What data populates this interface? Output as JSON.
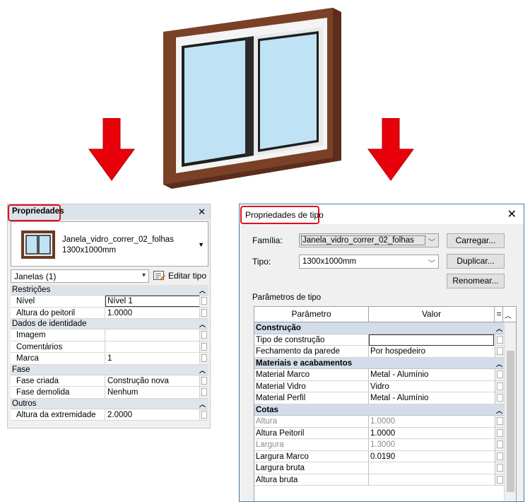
{
  "left_panel": {
    "title": "Propriedades",
    "close": "✕",
    "type_name": "Janela_vidro_correr_02_folhas",
    "type_size": "1300x1000mm",
    "type_dropdown": "▼",
    "instance_filter": "Janelas (1)",
    "edit_type": "Editar tipo",
    "categories": [
      {
        "name": "Restrições",
        "rows": [
          {
            "k": "Nível",
            "v": "Nível 1",
            "input": true
          },
          {
            "k": "Altura do peitoril",
            "v": "1.0000"
          }
        ]
      },
      {
        "name": "Dados de identidade",
        "rows": [
          {
            "k": "Imagem",
            "v": ""
          },
          {
            "k": "Comentários",
            "v": ""
          },
          {
            "k": "Marca",
            "v": "1"
          }
        ]
      },
      {
        "name": "Fase",
        "rows": [
          {
            "k": "Fase criada",
            "v": "Construção nova"
          },
          {
            "k": "Fase demolida",
            "v": "Nenhum"
          }
        ]
      },
      {
        "name": "Outros",
        "rows": [
          {
            "k": "Altura da extremidade",
            "v": "2.0000"
          }
        ]
      }
    ]
  },
  "type_dialog": {
    "title": "Propriedades de tipo",
    "close": "✕",
    "familia_label": "Família:",
    "familia_value": "Janela_vidro_correr_02_folhas",
    "tipo_label": "Tipo:",
    "tipo_value": "1300x1000mm",
    "btn_carregar": "Carregar...",
    "btn_duplicar": "Duplicar...",
    "btn_renomear": "Renomear...",
    "params_caption": "Parâmetros de tipo",
    "col_param": "Parâmetro",
    "col_valor": "Valor",
    "col_eq": "=",
    "categories": [
      {
        "name": "Construção",
        "rows": [
          {
            "k": "Tipo de construção",
            "v": "",
            "input": true
          },
          {
            "k": "Fechamento da parede",
            "v": "Por hospedeiro"
          }
        ]
      },
      {
        "name": "Materiais e acabamentos",
        "rows": [
          {
            "k": "Material Marco",
            "v": "Metal - Alumínio"
          },
          {
            "k": "Material Vidro",
            "v": "Vidro"
          },
          {
            "k": "Material Perfil",
            "v": "Metal - Alumínio"
          }
        ]
      },
      {
        "name": "Cotas",
        "rows": [
          {
            "k": "Altura",
            "v": "1.0000",
            "gray": true
          },
          {
            "k": "Altura Peitoril",
            "v": "1.0000"
          },
          {
            "k": "Largura",
            "v": "1.3000",
            "gray": true
          },
          {
            "k": "Largura Marco",
            "v": "0.0190"
          },
          {
            "k": "Largura bruta",
            "v": ""
          },
          {
            "k": "Altura bruta",
            "v": ""
          }
        ]
      }
    ]
  },
  "colors": {
    "highlight": "#e0101a",
    "arrow": "#e8000a",
    "frame": "#6b3a22"
  },
  "icons": [
    "close-icon",
    "chevron-up-icon",
    "dropdown-arrow-icon",
    "edit-type-icon",
    "window-thumbnail-icon",
    "down-arrow-icon"
  ]
}
